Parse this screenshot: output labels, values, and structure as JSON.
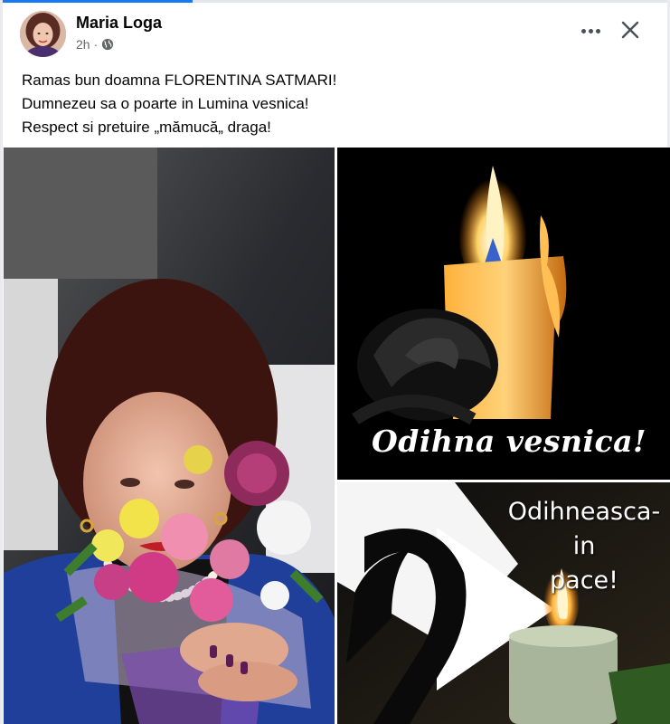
{
  "post": {
    "author": "Maria Loga",
    "time": "2h",
    "visibility_icon": "globe-icon",
    "text_lines": [
      "Ramas bun doamna FLORENTINA SATMARI!",
      "Dumnezeu sa o poarte in Lumina vesnica!",
      "Respect si pretuire „mămucă„ draga!"
    ]
  },
  "actions": {
    "more_icon": "more-options-icon",
    "close_icon": "close-icon"
  },
  "images": {
    "candle_caption": "Odihna vesnica!",
    "ribbon_caption_lines": [
      "Odihneasca-",
      "in",
      "pace!"
    ]
  },
  "colors": {
    "accent": "#1877f2",
    "text": "#050505",
    "secondary_text": "#65676b"
  }
}
